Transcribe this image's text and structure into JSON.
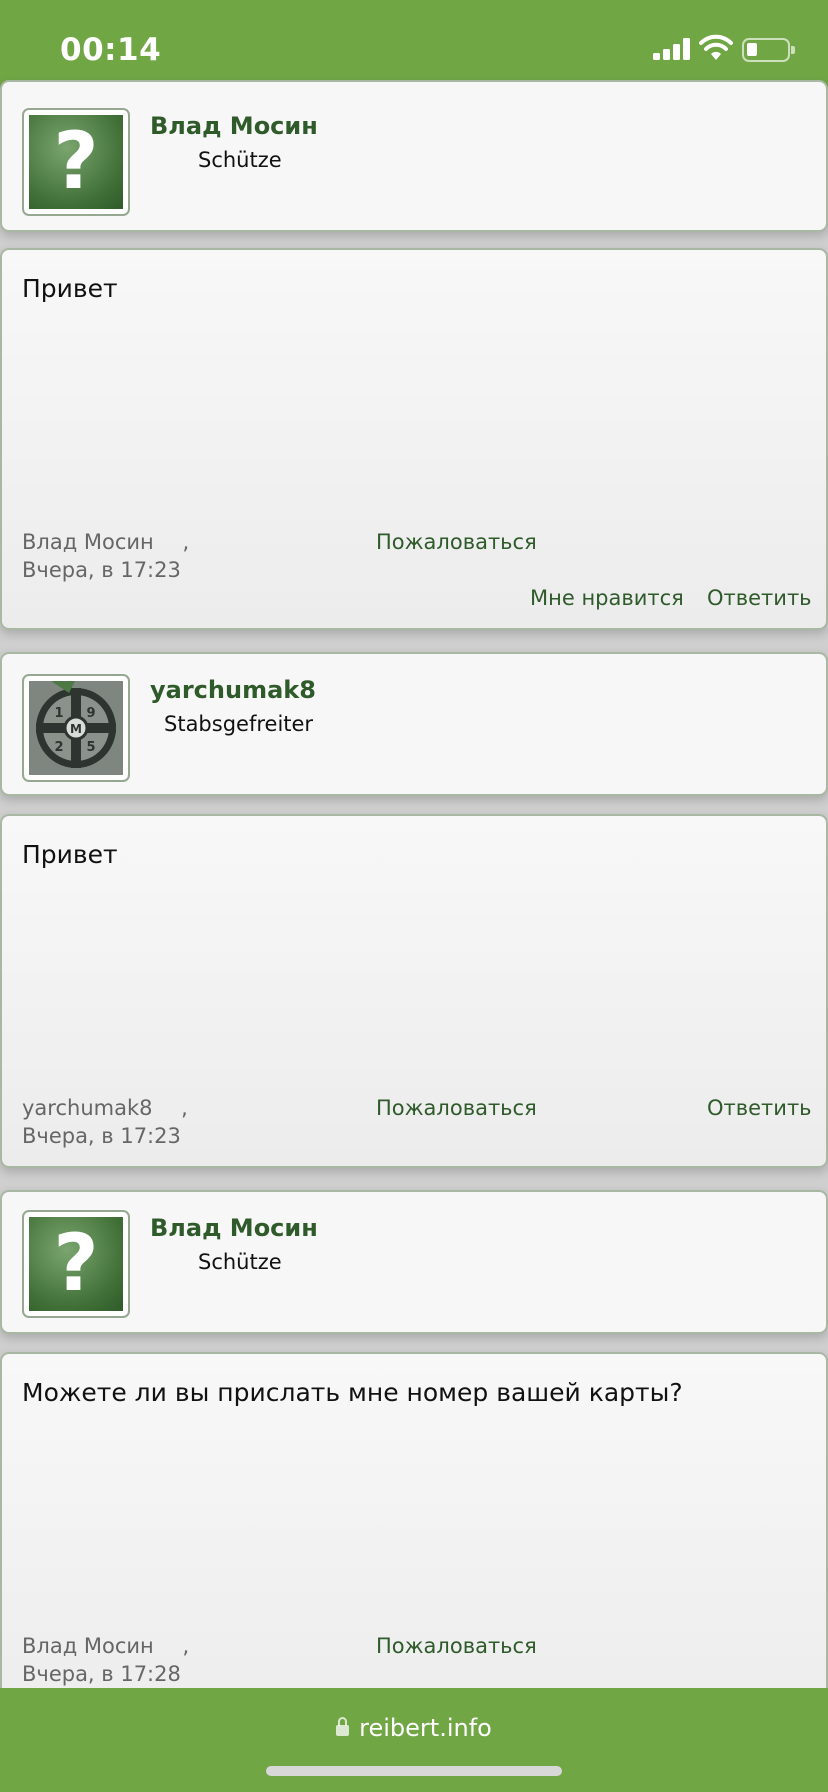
{
  "status_bar": {
    "time": "00:14"
  },
  "posts": [
    {
      "user": {
        "name": "Влад Мосин",
        "rank": "Schütze",
        "avatar": "question-mark-icon"
      },
      "message": "Привет",
      "author": "Влад Мосин",
      "comma": ",",
      "date": "Вчера, в 17:23",
      "report_label": "Пожаловаться",
      "like_label": "Мне нравится",
      "reply_label": "Ответить"
    },
    {
      "user": {
        "name": "yarchumak8",
        "rank": "Stabsgefreiter",
        "avatar": "emblem-photo"
      },
      "message": "Привет",
      "author": "yarchumak8",
      "comma": ",",
      "date": "Вчера, в 17:23",
      "report_label": "Пожаловаться",
      "reply_label": "Ответить"
    },
    {
      "user": {
        "name": "Влад Мосин",
        "rank": "Schütze",
        "avatar": "question-mark-icon"
      },
      "message": "Можете ли вы прислать мне номер вашей карты?",
      "author": "Влад Мосин",
      "comma": ",",
      "date": "Вчера, в 17:28",
      "report_label": "Пожаловаться"
    }
  ],
  "browser": {
    "url": "reibert.info"
  },
  "colors": {
    "brand_green": "#71a645",
    "link_green": "#2f5a2a"
  }
}
